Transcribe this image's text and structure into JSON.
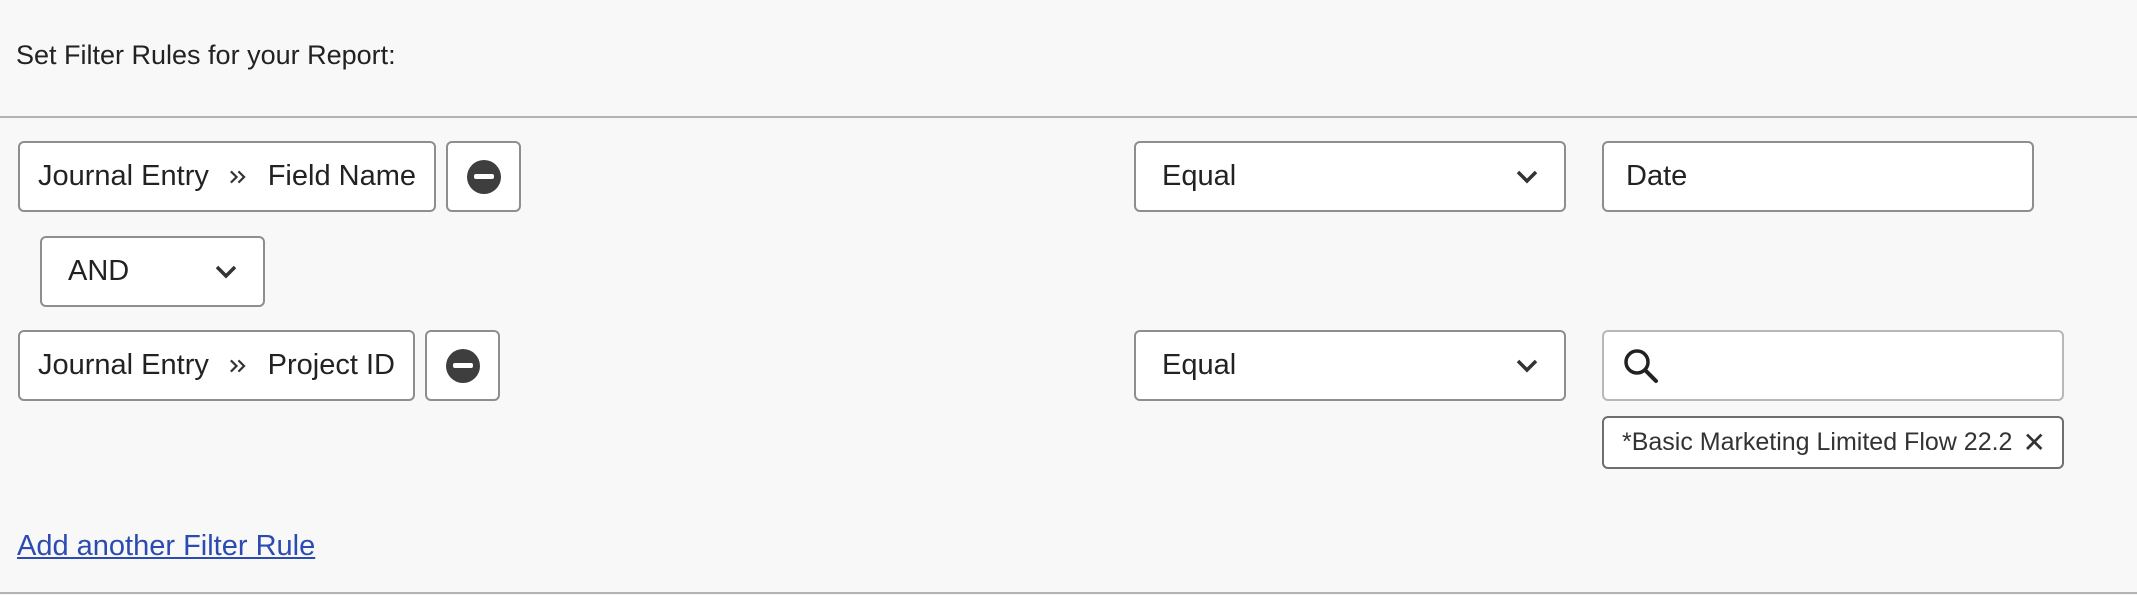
{
  "header": {
    "title": "Set Filter Rules for your Report:"
  },
  "rules": [
    {
      "entity": "Journal Entry",
      "field": "Field Name",
      "operator": "Equal",
      "value": "Date"
    },
    {
      "entity": "Journal Entry",
      "field": "Project ID",
      "operator": "Equal",
      "value": "",
      "selected_tags": [
        "*Basic Marketing Limited Flow 22.2"
      ]
    }
  ],
  "connector": {
    "selected": "AND"
  },
  "icons": {
    "breadcrumb_separator": "double-chevron-right-icon",
    "remove": "minus-circle-icon",
    "dropdown": "chevron-down-icon",
    "search": "search-icon",
    "tag_remove": "close-icon"
  },
  "tag_close_glyph": "✕",
  "add_rule": {
    "label": "Add another Filter Rule"
  },
  "colors": {
    "link": "#2c4bb0",
    "border": "#8e8e8e",
    "background": "#f8f8f8"
  }
}
